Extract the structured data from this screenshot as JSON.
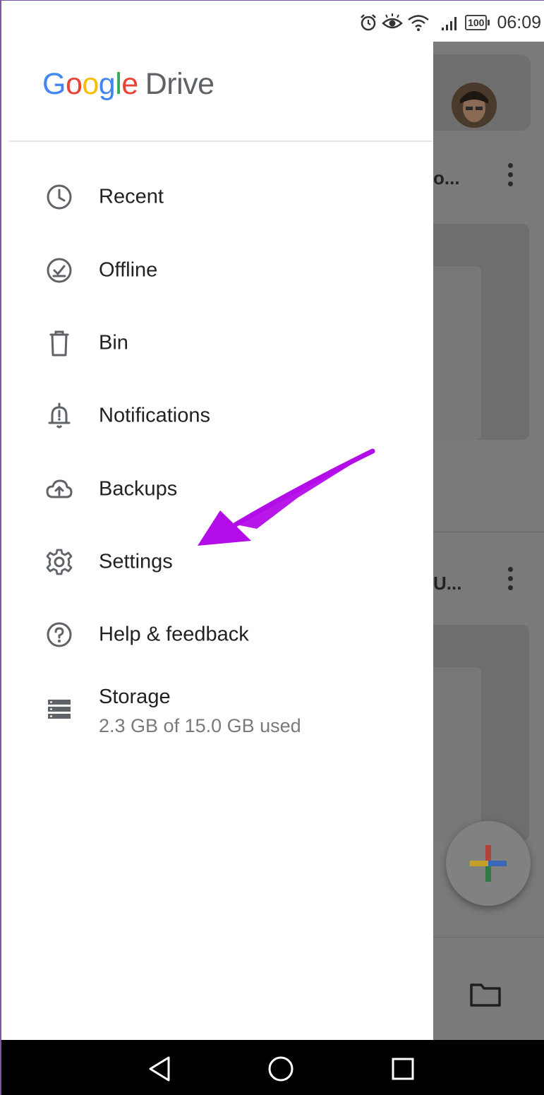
{
  "status_bar": {
    "time": "06:09",
    "battery": "100",
    "icons": [
      "alarm-icon",
      "eye-icon",
      "wifi-icon",
      "signal-icon",
      "battery-icon"
    ]
  },
  "drawer": {
    "logo_letters": [
      "G",
      "o",
      "o",
      "g",
      "l",
      "e"
    ],
    "logo_product": "Drive",
    "items": [
      {
        "label": "Recent",
        "icon": "clock-icon"
      },
      {
        "label": "Offline",
        "icon": "offline-check-icon"
      },
      {
        "label": "Bin",
        "icon": "trash-icon"
      },
      {
        "label": "Notifications",
        "icon": "bell-icon"
      },
      {
        "label": "Backups",
        "icon": "cloud-upload-icon"
      },
      {
        "label": "Settings",
        "icon": "gear-icon"
      },
      {
        "label": "Help & feedback",
        "icon": "help-icon"
      }
    ],
    "storage": {
      "label": "Storage",
      "usage": "2.3 GB of 15.0 GB used",
      "icon": "storage-icon"
    }
  },
  "background": {
    "item1_trunc": "o...",
    "item2_trunc": "U..."
  },
  "colors": {
    "google_blue": "#4285F4",
    "google_red": "#EA4335",
    "google_yellow": "#FBBC05",
    "google_green": "#34A853",
    "annotation_arrow": "#B30CE8",
    "scrim": "#7a7a7a"
  },
  "annotation": {
    "type": "arrow",
    "points_to": "Settings"
  }
}
